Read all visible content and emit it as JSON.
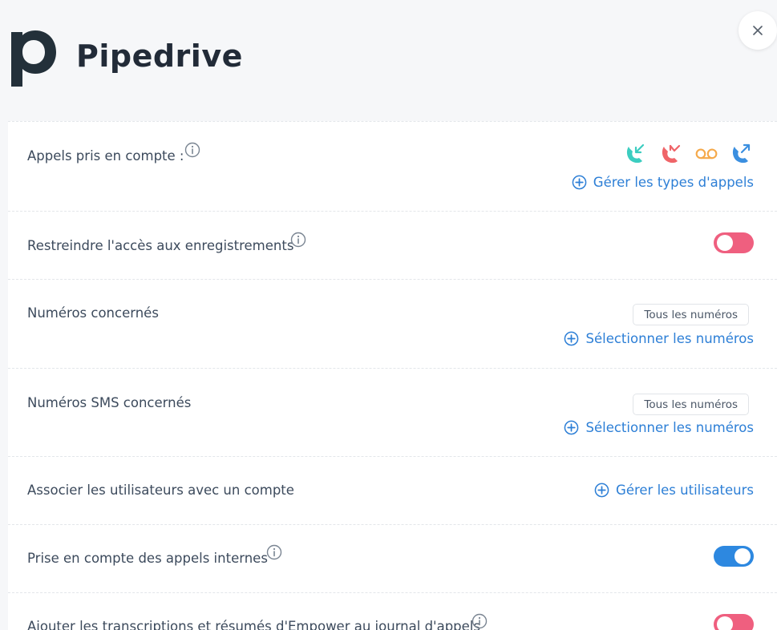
{
  "app": {
    "logo_letter": "p",
    "title": "Pipedrive"
  },
  "colors": {
    "accent_blue": "#2d7fd6",
    "toggle_off": "#ef5f7f",
    "toggle_on": "#2d88e0",
    "call_incoming": "#3ccdc0",
    "call_missed": "#ef6468",
    "voicemail": "#f5a94a",
    "call_outgoing": "#3b8fe0"
  },
  "rows": {
    "calls": {
      "label": "Appels pris en compte :",
      "icons": [
        "incoming-call-icon",
        "missed-call-icon",
        "voicemail-icon",
        "outgoing-call-icon"
      ],
      "action": "Gérer les types d'appels"
    },
    "recordings": {
      "label": "Restreindre l'accès aux enregistrements",
      "toggle": "off"
    },
    "numbers": {
      "label": "Numéros concernés",
      "chip": "Tous les numéros",
      "action": "Sélectionner les numéros"
    },
    "sms_numbers": {
      "label": "Numéros SMS concernés",
      "chip": "Tous les numéros",
      "action": "Sélectionner les numéros"
    },
    "users": {
      "label": "Associer les utilisateurs avec un compte",
      "action": "Gérer les utilisateurs"
    },
    "internal_calls": {
      "label": "Prise en compte des appels internes",
      "toggle": "on"
    },
    "transcripts": {
      "label": "Ajouter les transcriptions et résumés d'Empower au journal d'appels",
      "toggle": "off"
    }
  }
}
